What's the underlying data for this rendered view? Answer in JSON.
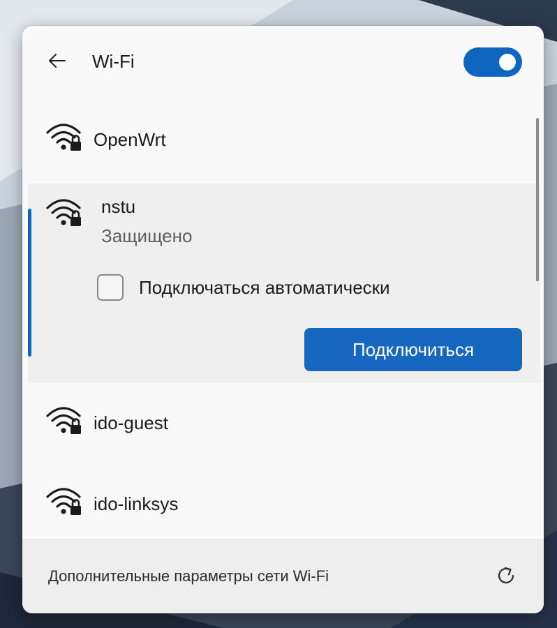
{
  "header": {
    "back_icon": "arrow-left-icon",
    "title": "Wi-Fi",
    "toggle_on": true,
    "accent_color": "#0f66c0"
  },
  "networks": [
    {
      "name": "OpenWrt",
      "icon": "wifi-locked-icon"
    },
    {
      "name": "nstu",
      "icon": "wifi-locked-icon",
      "expanded": true,
      "status": "Защищено",
      "auto_connect_label": "Подключаться автоматически",
      "auto_connect_checked": false,
      "connect_label": "Подключиться"
    },
    {
      "name": "ido-guest",
      "icon": "wifi-locked-icon"
    },
    {
      "name": "ido-linksys",
      "icon": "wifi-locked-icon"
    }
  ],
  "footer": {
    "link_label": "Дополнительные параметры сети Wi-Fi",
    "refresh_icon": "refresh-icon"
  }
}
